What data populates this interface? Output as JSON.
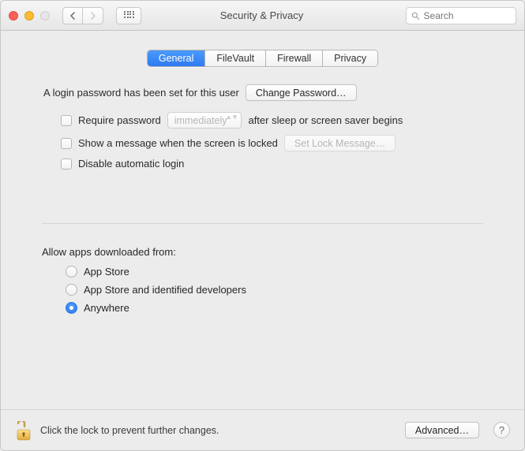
{
  "window": {
    "title": "Security & Privacy",
    "search_placeholder": "Search"
  },
  "tabs": [
    {
      "label": "General",
      "selected": true
    },
    {
      "label": "FileVault",
      "selected": false
    },
    {
      "label": "Firewall",
      "selected": false
    },
    {
      "label": "Privacy",
      "selected": false
    }
  ],
  "login": {
    "status_text": "A login password has been set for this user",
    "change_password_label": "Change Password…",
    "require_password_label": "Require password",
    "require_password_popup_value": "immediately",
    "require_password_suffix": "after sleep or screen saver begins",
    "show_message_label": "Show a message when the screen is locked",
    "set_lock_message_label": "Set Lock Message…",
    "disable_auto_login_label": "Disable automatic login",
    "require_password_checked": false,
    "show_message_checked": false,
    "disable_auto_login_checked": false
  },
  "gatekeeper": {
    "heading": "Allow apps downloaded from:",
    "options": [
      {
        "label": "App Store",
        "selected": false
      },
      {
        "label": "App Store and identified developers",
        "selected": false
      },
      {
        "label": "Anywhere",
        "selected": true
      }
    ]
  },
  "footer": {
    "lock_text": "Click the lock to prevent further changes.",
    "advanced_label": "Advanced…",
    "help_label": "?"
  }
}
